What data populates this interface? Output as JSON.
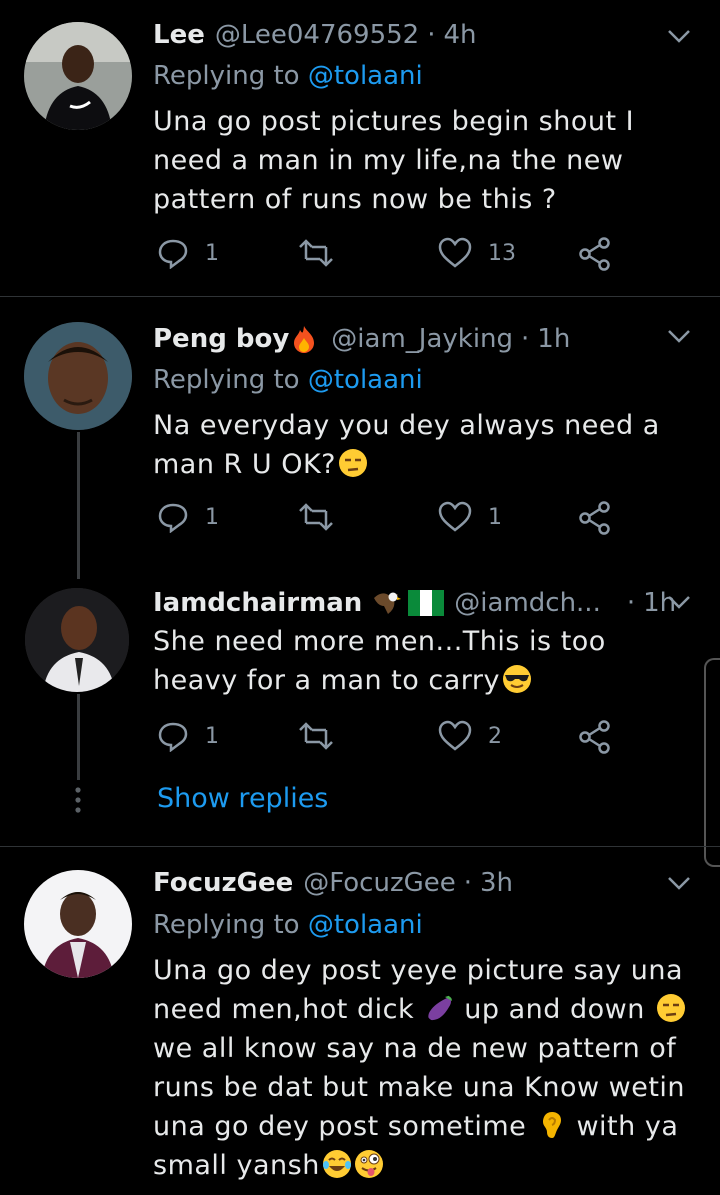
{
  "tweets": [
    {
      "name": "Lee",
      "handle": "@Lee04769552",
      "time": "4h",
      "replying_prefix": "Replying to ",
      "replying_to": "@tolaani",
      "text": "Una go post pictures begin shout I need a man in my life,na the new pattern of runs now be this ?",
      "replies": "1",
      "likes": "13"
    },
    {
      "name": "Peng boy",
      "handle": "@iam_Jayking",
      "time": "1h",
      "replying_prefix": "Replying to ",
      "replying_to": "@tolaani",
      "text": "Na everyday you dey always need a man R U OK?",
      "replies": "1",
      "likes": "1"
    },
    {
      "name": "Iamdchairman",
      "handle": "@iamdch...",
      "time": "1h",
      "text": "She need more men...This is too heavy for a man to carry",
      "replies": "1",
      "likes": "2"
    },
    {
      "name": "FocuzGee",
      "handle": "@FocuzGee",
      "time": "3h",
      "replying_prefix": "Replying to ",
      "replying_to": "@tolaani",
      "text_parts": [
        "Una go dey post yeye picture say una need men,hot dick ",
        " up and down ",
        " we all know say na de new pattern of runs be dat but make una Know wetin una go dey post sometime ",
        " with ya small yansh"
      ]
    }
  ],
  "show_replies": "Show replies",
  "separator": "·",
  "colors": {
    "background": "#000000",
    "text": "#e7e9ea",
    "muted": "#8b98a5",
    "link": "#1d9bf0",
    "divider": "#2f3336"
  },
  "icons": [
    "reply-icon",
    "retweet-icon",
    "like-icon",
    "share-icon",
    "chevron-down-icon",
    "fire-emoji",
    "eagle-emoji",
    "nigeria-flag-emoji",
    "unamused-emoji",
    "sunglasses-emoji",
    "eggplant-emoji",
    "ear-emoji",
    "joy-emoji",
    "zany-emoji"
  ]
}
